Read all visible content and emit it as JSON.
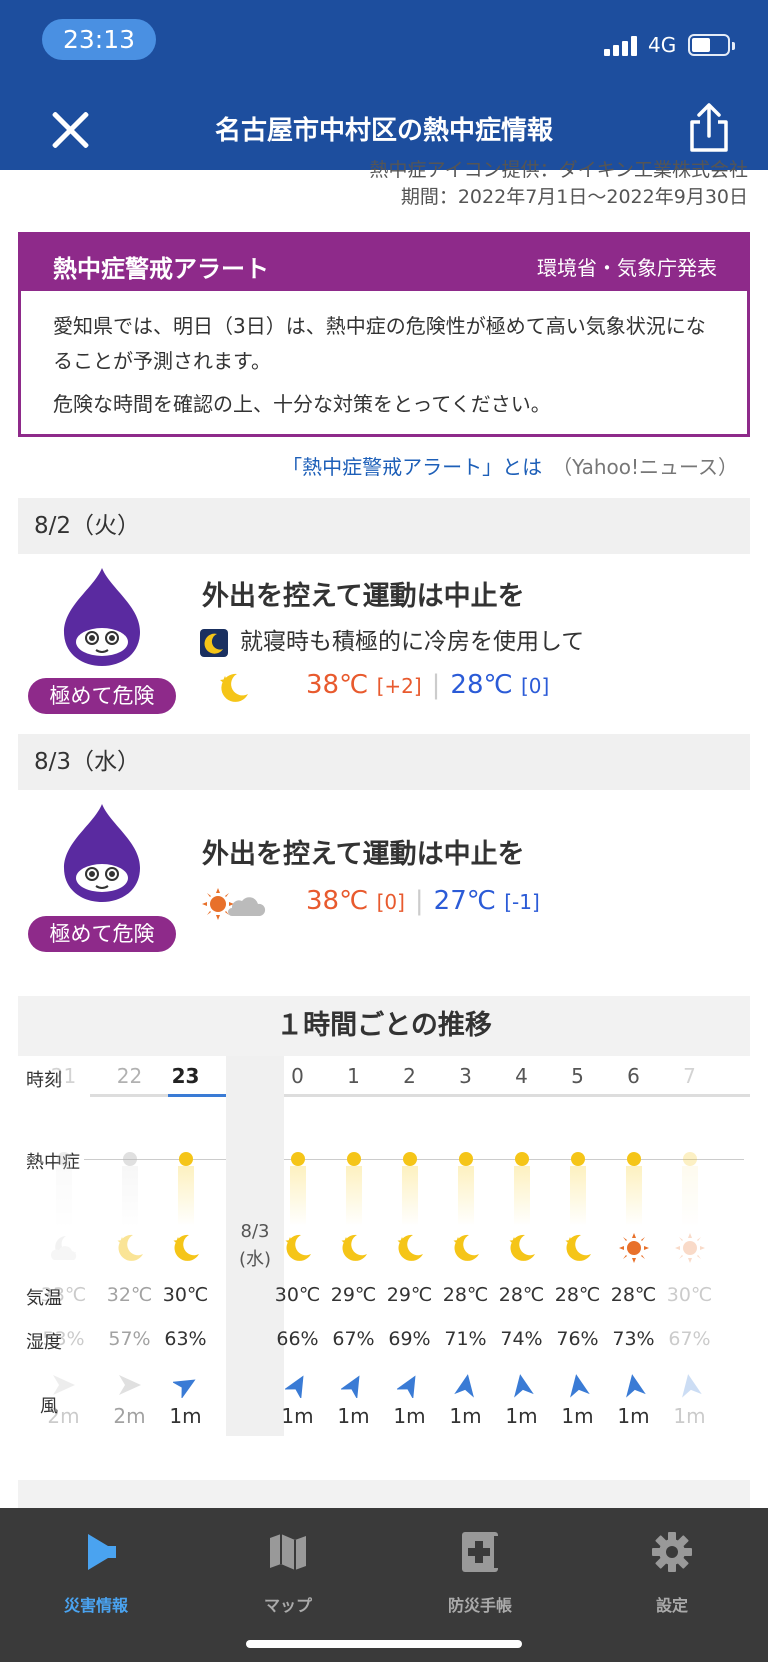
{
  "status": {
    "time": "23:13",
    "network": "4G"
  },
  "header": {
    "title": "名古屋市中村区の熱中症情報"
  },
  "credit": {
    "line1": "熱中症アイコン提供：ダイキン工業株式会社",
    "period": "期間：2022年7月1日〜2022年9月30日"
  },
  "alert": {
    "title": "熱中症警戒アラート",
    "source": "環境省・気象庁発表",
    "line1": "愛知県では、明日（3日）は、熱中症の危険性が極めて高い気象状況になることが予測されます。",
    "line2": "危険な時間を確認の上、十分な対策をとってください。",
    "link_text": "「熱中症警戒アラート」とは",
    "link_source": "（Yahoo!ニュース）"
  },
  "days": [
    {
      "date": "8/2（火）",
      "level": "極めて危険",
      "advice": "外出を控えて運動は中止を",
      "sub_advice": "就寝時も積極的に冷房を使用して",
      "high": "38℃",
      "high_diff": "[+2]",
      "low": "28℃",
      "low_diff": "[0]",
      "weather_icon": "moon-icon"
    },
    {
      "date": "8/3（水）",
      "level": "極めて危険",
      "advice": "外出を控えて運動は中止を",
      "high": "38℃",
      "high_diff": "[0]",
      "low": "27℃",
      "low_diff": "[-1]",
      "weather_icon": "sun-cloud-icon"
    }
  ],
  "hourly": {
    "title": "１時間ごとの推移",
    "labels": {
      "time": "時刻",
      "heat": "熱中症",
      "temp": "気温",
      "humidity": "湿度",
      "wind": "風"
    },
    "date_separator": "8/3\n(水)",
    "hours": [
      {
        "hour": "21",
        "temp": "33℃",
        "humidity": "53%",
        "wind": "2m",
        "icon": "cloud-moon-icon",
        "heat_level": "warning"
      },
      {
        "hour": "22",
        "temp": "32℃",
        "humidity": "57%",
        "wind": "2m",
        "icon": "moon-icon",
        "heat_level": "warning"
      },
      {
        "hour": "23",
        "temp": "30℃",
        "humidity": "63%",
        "wind": "1m",
        "icon": "moon-icon",
        "heat_level": "danger"
      },
      {
        "hour": "0",
        "temp": "30℃",
        "humidity": "66%",
        "wind": "1m",
        "icon": "moon-icon",
        "heat_level": "danger"
      },
      {
        "hour": "1",
        "temp": "29℃",
        "humidity": "67%",
        "wind": "1m",
        "icon": "moon-icon",
        "heat_level": "danger"
      },
      {
        "hour": "2",
        "temp": "29℃",
        "humidity": "69%",
        "wind": "1m",
        "icon": "moon-icon",
        "heat_level": "danger"
      },
      {
        "hour": "3",
        "temp": "28℃",
        "humidity": "71%",
        "wind": "1m",
        "icon": "moon-icon",
        "heat_level": "danger"
      },
      {
        "hour": "4",
        "temp": "28℃",
        "humidity": "74%",
        "wind": "1m",
        "icon": "moon-icon",
        "heat_level": "danger"
      },
      {
        "hour": "5",
        "temp": "28℃",
        "humidity": "76%",
        "wind": "1m",
        "icon": "moon-icon",
        "heat_level": "danger"
      },
      {
        "hour": "6",
        "temp": "28℃",
        "humidity": "73%",
        "wind": "1m",
        "icon": "sun-icon",
        "heat_level": "danger"
      },
      {
        "hour": "7",
        "temp": "30℃",
        "humidity": "67%",
        "wind": "1m",
        "icon": "sun-icon",
        "heat_level": "danger"
      }
    ]
  },
  "tabs": [
    {
      "label": "災害情報",
      "icon": "megaphone-icon",
      "active": true
    },
    {
      "label": "マップ",
      "icon": "map-icon",
      "active": false
    },
    {
      "label": "防災手帳",
      "icon": "first-aid-book-icon",
      "active": false
    },
    {
      "label": "設定",
      "icon": "gear-icon",
      "active": false
    }
  ],
  "colors": {
    "header": "#1d4e9e",
    "alert": "#8e2a8a",
    "high_temp": "#e85a2e",
    "low_temp": "#2b5bd7",
    "tab_active": "#4aa3f0"
  }
}
